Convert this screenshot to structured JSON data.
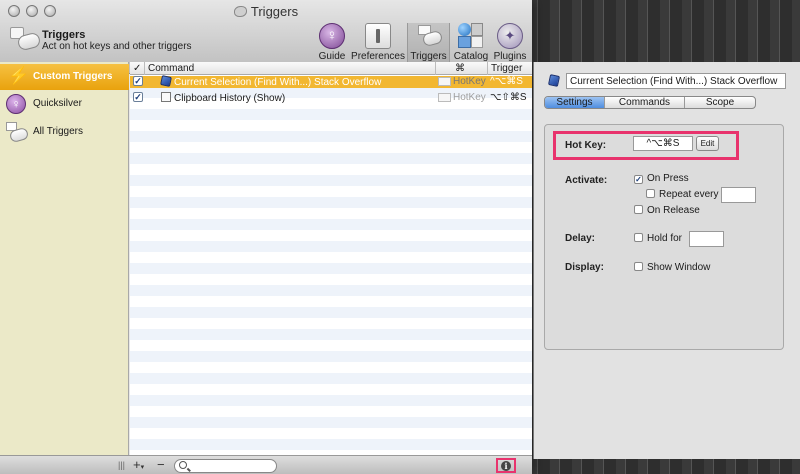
{
  "window": {
    "title": "Triggers"
  },
  "toolbar": {
    "heading": "Triggers",
    "description": "Act on hot keys and other triggers",
    "buttons": [
      {
        "label": "Guide",
        "icon": "guide-icon"
      },
      {
        "label": "Preferences",
        "icon": "preferences-icon"
      },
      {
        "label": "Triggers",
        "icon": "triggers-icon",
        "selected": true
      },
      {
        "label": "Catalog",
        "icon": "catalog-icon"
      },
      {
        "label": "Plugins",
        "icon": "plugins-icon"
      }
    ]
  },
  "sidebar": {
    "items": [
      {
        "label": "Custom Triggers",
        "icon": "lightning-icon",
        "selected": true
      },
      {
        "label": "Quicksilver",
        "icon": "quicksilver-icon"
      },
      {
        "label": "All Triggers",
        "icon": "triggers-icon"
      }
    ]
  },
  "table": {
    "headers": {
      "check": "✓",
      "command": "Command",
      "type": "⌘",
      "trigger": "Trigger"
    },
    "rows": [
      {
        "checked": true,
        "command": "Current Selection (Find With...)  Stack Overflow",
        "icon": "cube-icon",
        "type": "HotKey",
        "trigger": "^⌥⌘S",
        "selected": true
      },
      {
        "checked": true,
        "command": "Clipboard History (Show)",
        "icon": "document-icon",
        "type": "HotKey",
        "trigger": "⌥⇧⌘S",
        "selected": false
      }
    ]
  },
  "bottombar": {
    "add_label": "+",
    "add_menu_glyph": "▾",
    "remove_label": "−",
    "drag_handle": "|||",
    "search": {
      "value": "",
      "placeholder": ""
    },
    "info_label": "i"
  },
  "inspector": {
    "name": "Current Selection (Find With...)  Stack Overflow",
    "tabs": [
      "Settings",
      "Commands",
      "Scope"
    ],
    "active_tab": "Settings",
    "hotkey_label": "Hot Key:",
    "hotkey_value": "^⌥⌘S",
    "edit_label": "Edit",
    "activate_label": "Activate:",
    "on_press": {
      "label": "On Press",
      "checked": true
    },
    "repeat_every": {
      "label": "Repeat every",
      "checked": false,
      "value": ""
    },
    "on_release": {
      "label": "On Release",
      "checked": false
    },
    "delay_label": "Delay:",
    "hold_for": {
      "label": "Hold for",
      "checked": false,
      "value": ""
    },
    "display_label": "Display:",
    "show_window": {
      "label": "Show Window",
      "checked": false
    }
  },
  "colors": {
    "selection": "#f2b731",
    "highlight_annotation": "#e8336d",
    "sidebar_bg": "#ebe9c8",
    "segment_active": "#4f8ee0"
  }
}
